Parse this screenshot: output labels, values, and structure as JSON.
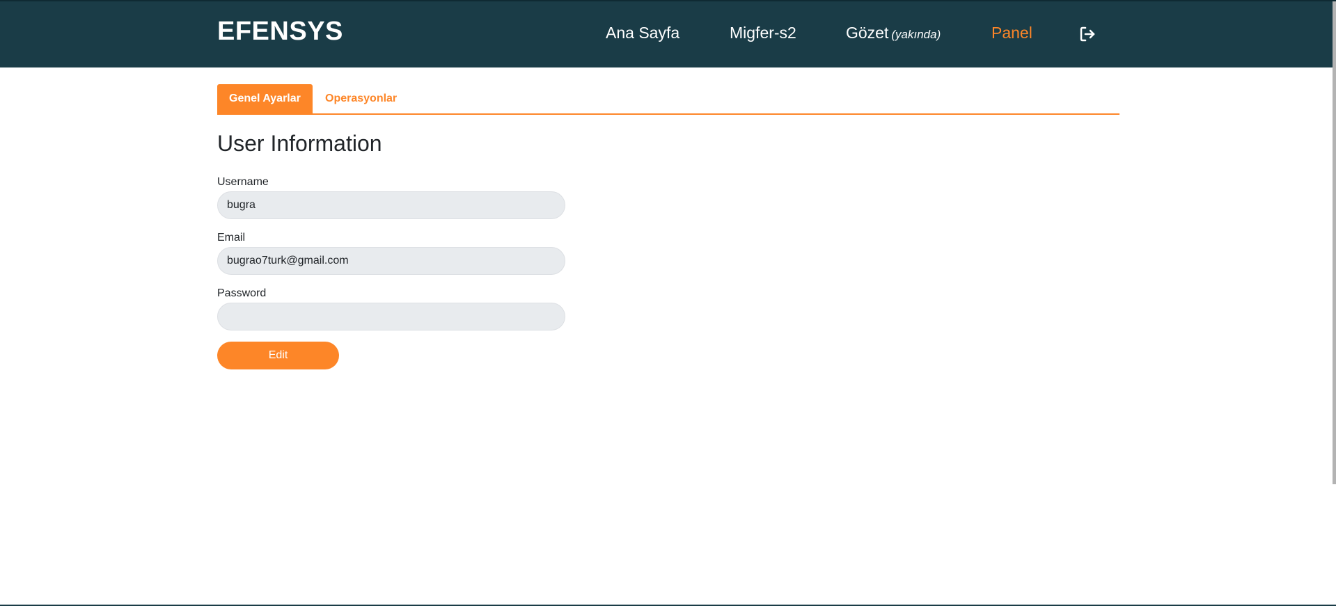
{
  "header": {
    "brand": "EFENSYS",
    "nav": {
      "home": "Ana Sayfa",
      "migfer": "Migfer-s2",
      "gozet": "Gözet",
      "gozet_note": "(yakında)",
      "panel": "Panel"
    },
    "logout_icon": "logout-icon",
    "active_color": "#fd8628",
    "background_color": "#1a3c47"
  },
  "tabs": {
    "general": "Genel Ayarlar",
    "operations": "Operasyonlar",
    "active": "Genel Ayarlar"
  },
  "section": {
    "title": "User Information"
  },
  "form": {
    "username_label": "Username",
    "username_value": "bugra",
    "email_label": "Email",
    "email_value": "bugrao7turk@gmail.com",
    "password_label": "Password",
    "password_value": "",
    "edit_label": "Edit"
  }
}
